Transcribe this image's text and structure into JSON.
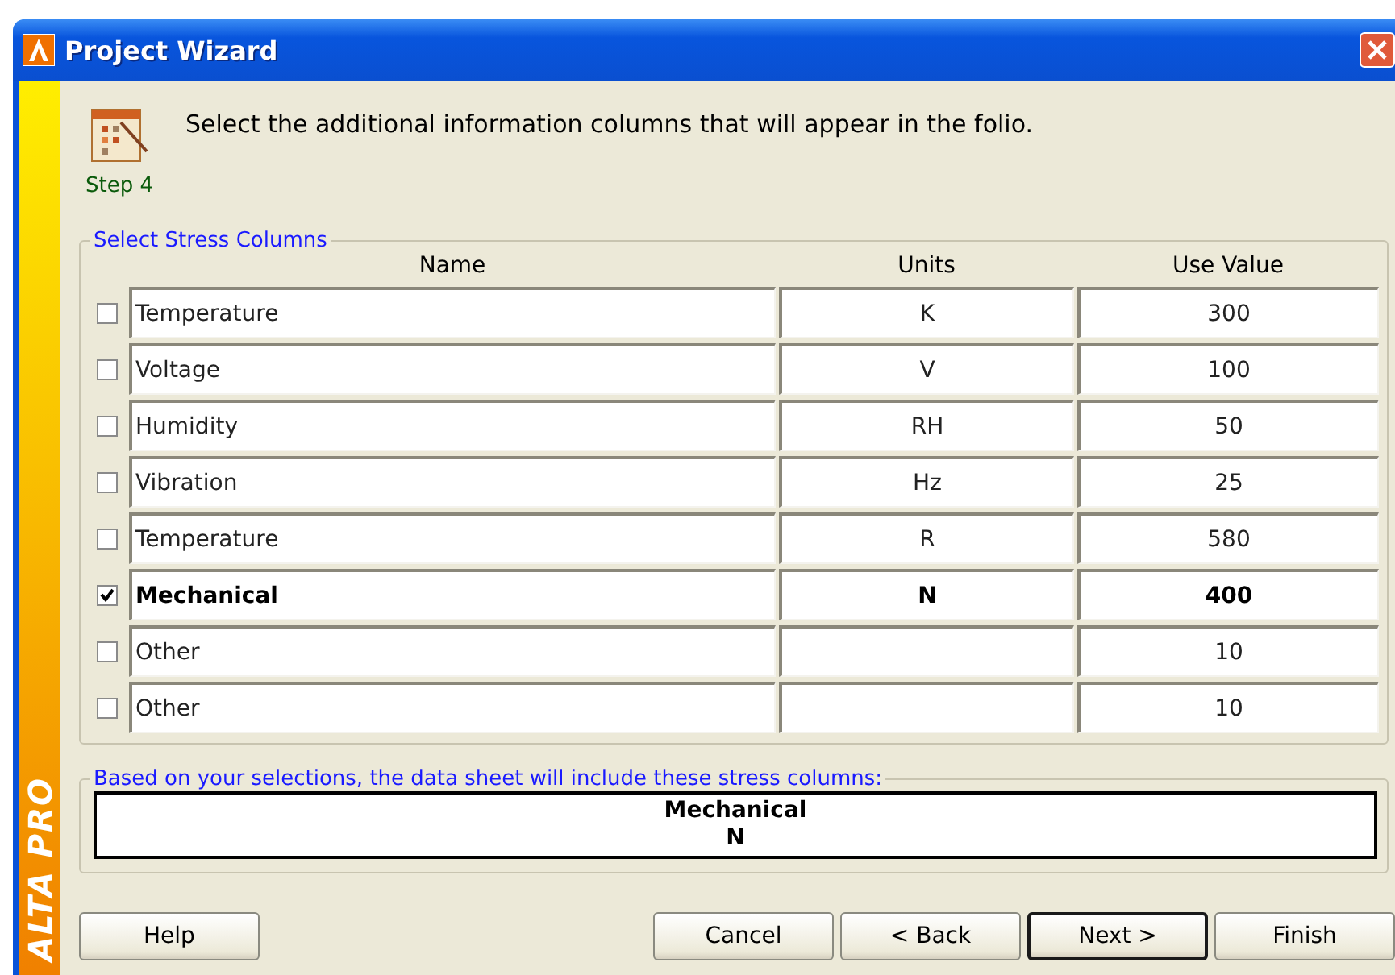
{
  "window": {
    "title": "Project Wizard",
    "side_banner": "ALTA PRO"
  },
  "header": {
    "instruction": "Select the additional information columns that will appear in the folio.",
    "step": "Step 4"
  },
  "stress_columns": {
    "legend": "Select Stress Columns",
    "columns": [
      "Name",
      "Units",
      "Use Value"
    ],
    "rows": [
      {
        "checked": false,
        "name": "Temperature",
        "units": "K",
        "value": "300"
      },
      {
        "checked": false,
        "name": "Voltage",
        "units": "V",
        "value": "100"
      },
      {
        "checked": false,
        "name": "Humidity",
        "units": "RH",
        "value": "50"
      },
      {
        "checked": false,
        "name": "Vibration",
        "units": "Hz",
        "value": "25"
      },
      {
        "checked": false,
        "name": "Temperature",
        "units": "R",
        "value": "580"
      },
      {
        "checked": true,
        "name": "Mechanical",
        "units": "N",
        "value": "400"
      },
      {
        "checked": false,
        "name": "Other",
        "units": "",
        "value": "10"
      },
      {
        "checked": false,
        "name": "Other",
        "units": "",
        "value": "10"
      }
    ]
  },
  "summary": {
    "legend": "Based on your selections, the data sheet will include these stress columns:",
    "lines": [
      "Mechanical",
      "N"
    ]
  },
  "buttons": [
    {
      "label": "Help",
      "default": false
    },
    {
      "label": "Cancel",
      "default": false
    },
    {
      "label": "< Back",
      "default": false
    },
    {
      "label": "Next >",
      "default": true
    },
    {
      "label": "Finish",
      "default": false
    }
  ]
}
